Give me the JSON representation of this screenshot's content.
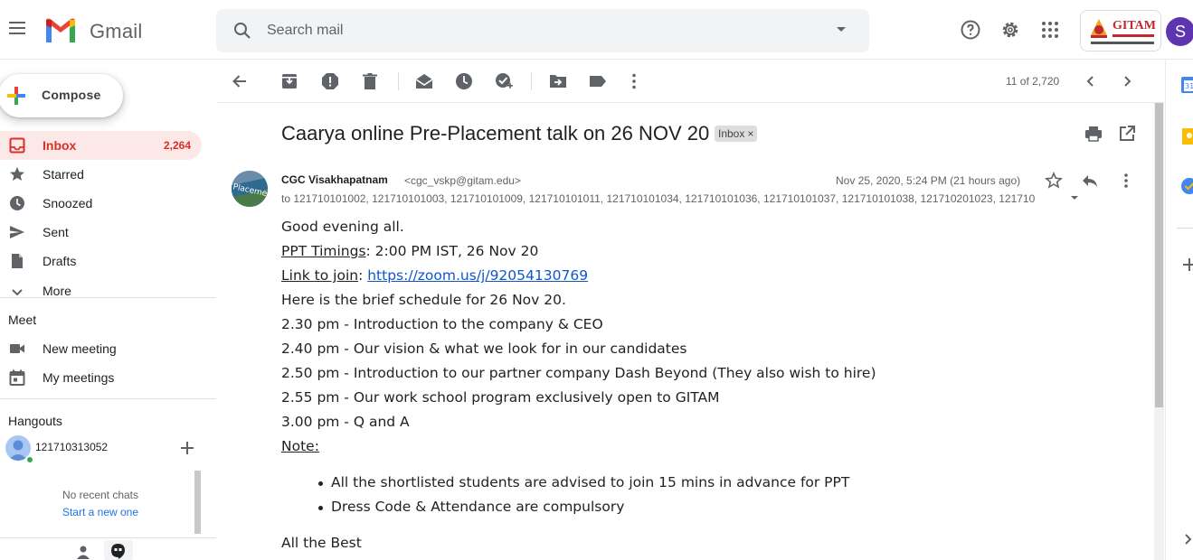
{
  "app": {
    "name": "Gmail",
    "account_initial": "S",
    "org_logo_text": "GITAM"
  },
  "search": {
    "placeholder": "Search mail"
  },
  "sidebar": {
    "compose_label": "Compose",
    "items": [
      {
        "label": "Inbox",
        "count": "2,264",
        "icon": "inbox-icon",
        "active": true
      },
      {
        "label": "Starred",
        "icon": "star-icon"
      },
      {
        "label": "Snoozed",
        "icon": "clock-icon"
      },
      {
        "label": "Sent",
        "icon": "send-icon"
      },
      {
        "label": "Drafts",
        "icon": "draft-icon"
      },
      {
        "label": "More",
        "icon": "chevron-down-icon"
      }
    ],
    "meet": {
      "title": "Meet",
      "items": [
        {
          "label": "New meeting",
          "icon": "video-icon"
        },
        {
          "label": "My meetings",
          "icon": "calendar-icon"
        }
      ]
    },
    "hangouts": {
      "title": "Hangouts",
      "user": "121710313052",
      "no_chats": "No recent chats",
      "start_new": "Start a new one"
    }
  },
  "toolbar": {
    "pager": "11 of 2,720"
  },
  "email": {
    "subject": "Caarya online Pre-Placement talk on 26 NOV 20",
    "label_chip": "Inbox",
    "sender_name": "CGC Visakhapatnam",
    "sender_email": "<cgc_vskp@gitam.edu>",
    "date": "Nov 25, 2020, 5:24 PM (21 hours ago)",
    "to": "to 121710101002, 121710101003, 121710101009, 121710101011, 121710101034, 121710101036, 121710101037, 121710101038, 121710201023, 121710",
    "avatar_text": "Placement",
    "body": {
      "greeting": "Good evening all.",
      "ppt_label": "PPT Timings",
      "ppt_value": ": 2:00 PM IST, 26 Nov 20",
      "link_label": "Link to join",
      "link_sep": ": ",
      "link_url": "https://zoom.us/j/92054130769",
      "schedule_intro": "Here is the brief schedule for 26 Nov 20.",
      "schedule": [
        "2.30 pm - Introduction to the company & CEO",
        "2.40 pm - Our vision & what we look for in our candidates",
        "2.50 pm - Introduction to our partner company Dash Beyond (They also wish to hire)",
        "2.55 pm - Our work school program exclusively open to GITAM",
        "3.00 pm - Q and A"
      ],
      "note_label": "Note:",
      "notes": [
        "All the shortlisted students are advised to join 15 mins in advance for PPT",
        "Dress Code & Attendance are compulsory"
      ],
      "closing": "All the Best"
    }
  },
  "colors": {
    "accent_red": "#d93025",
    "active_bg": "#fce8e6",
    "link_blue": "#1155cc",
    "avatar_purple": "#5e35b1"
  }
}
